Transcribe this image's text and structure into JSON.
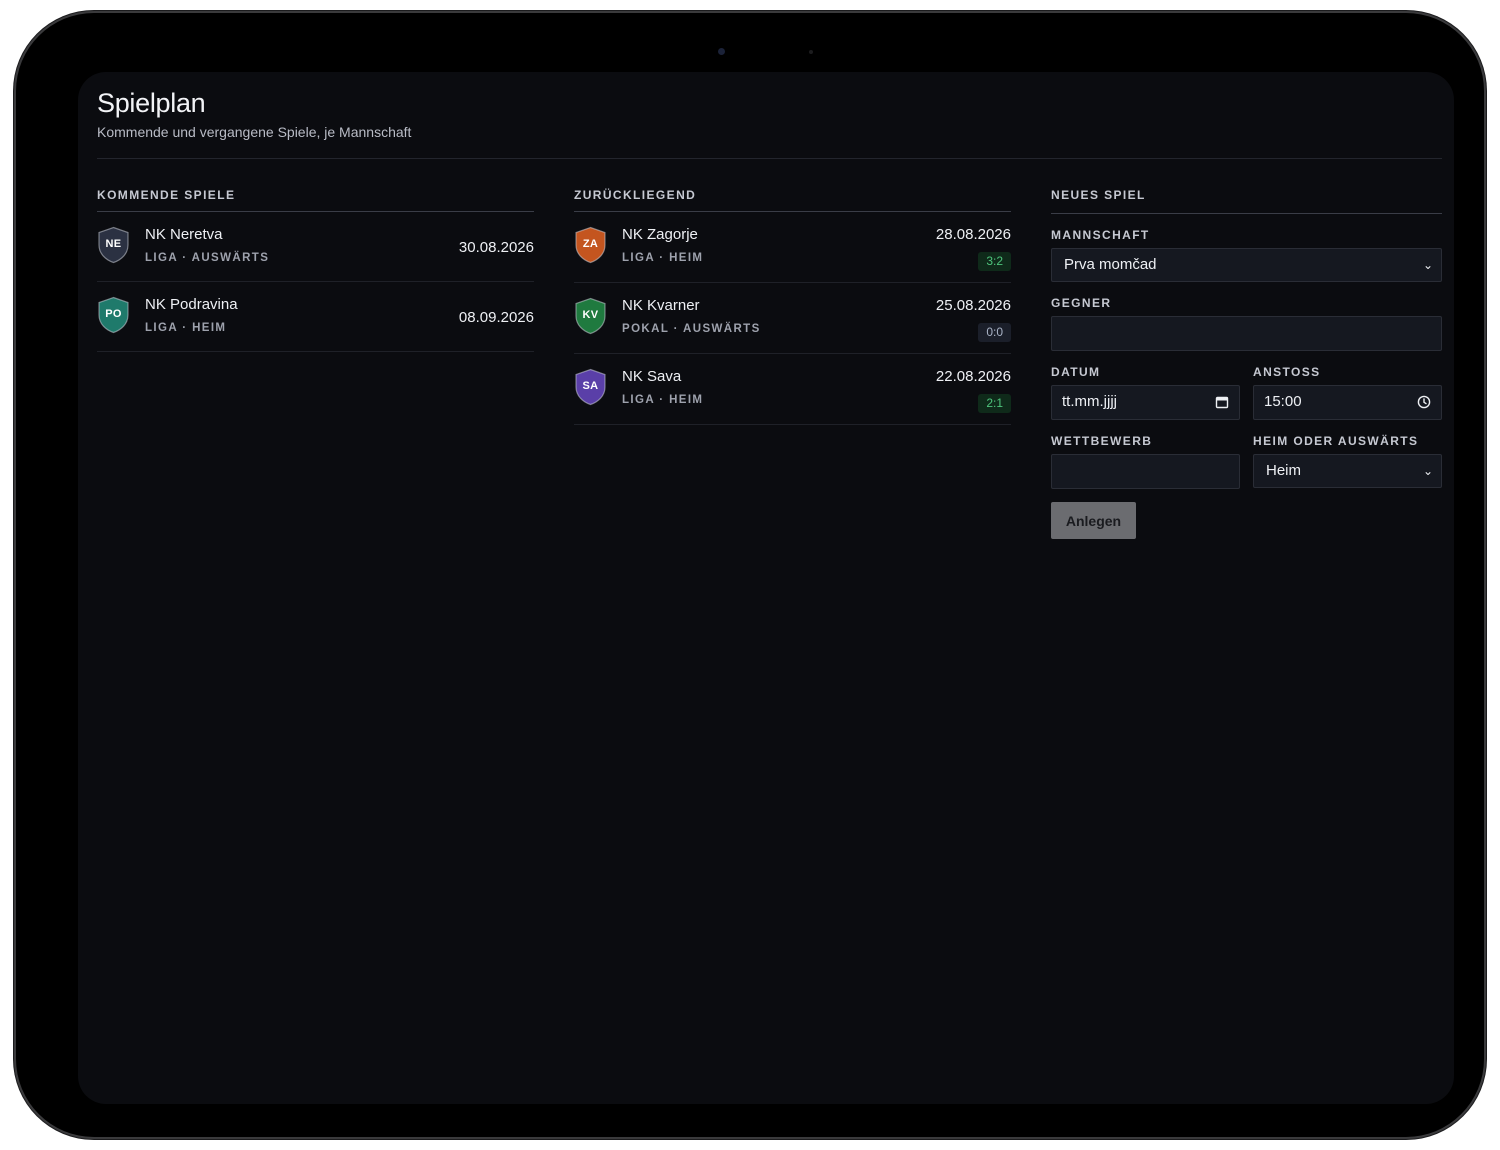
{
  "header": {
    "title": "Spielplan",
    "subtitle": "Kommende und vergangene Spiele, je Mannschaft"
  },
  "upcoming": {
    "title": "KOMMENDE SPIELE",
    "matches": [
      {
        "initials": "NE",
        "opponent": "NK Neretva",
        "meta": "LIGA · AUSWÄRTS",
        "date": "30.08.2026",
        "crest_color": "#2b3142"
      },
      {
        "initials": "PO",
        "opponent": "NK Podravina",
        "meta": "LIGA · HEIM",
        "date": "08.09.2026",
        "crest_color": "#1f7a6b"
      }
    ]
  },
  "past": {
    "title": "ZURÜCKLIEGEND",
    "matches": [
      {
        "initials": "ZA",
        "opponent": "NK Zagorje",
        "meta": "LIGA · HEIM",
        "date": "28.08.2026",
        "score": "3:2",
        "result": "win",
        "crest_color": "#c4551f"
      },
      {
        "initials": "KV",
        "opponent": "NK Kvarner",
        "meta": "POKAL · AUSWÄRTS",
        "date": "25.08.2026",
        "score": "0:0",
        "result": "draw",
        "crest_color": "#1f7a3f"
      },
      {
        "initials": "SA",
        "opponent": "NK Sava",
        "meta": "LIGA · HEIM",
        "date": "22.08.2026",
        "score": "2:1",
        "result": "win",
        "crest_color": "#5a3fa8"
      }
    ]
  },
  "form": {
    "title": "NEUES SPIEL",
    "team_label": "MANNSCHAFT",
    "team_value": "Prva momčad",
    "opponent_label": "GEGNER",
    "opponent_value": "",
    "date_label": "DATUM",
    "date_placeholder": "tt.mm.jjjj",
    "kickoff_label": "ANSTOSS",
    "kickoff_value": "15:00",
    "competition_label": "WETTBEWERB",
    "competition_value": "",
    "venue_label": "HEIM ODER AUSWÄRTS",
    "venue_value": "Heim",
    "submit_label": "Anlegen"
  },
  "icons": {
    "select": "chevron-down-icon",
    "date": "calendar-icon",
    "time": "clock-icon",
    "crest": "shield-icon"
  }
}
